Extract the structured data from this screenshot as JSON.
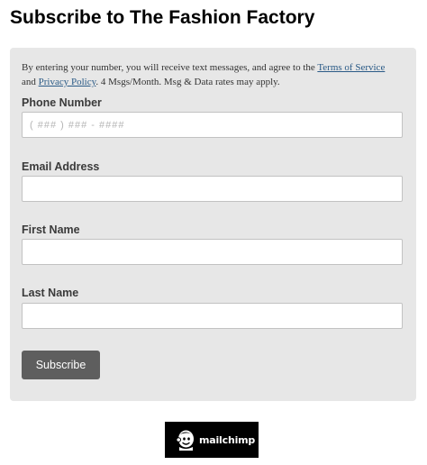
{
  "page": {
    "title": "Subscribe to The Fashion Factory"
  },
  "form": {
    "disclaimer": {
      "prefix": "By entering your number, you will receive text messages, and agree to the ",
      "terms_link": "Terms of Service",
      "middle": " and ",
      "privacy_link": "Privacy Policy",
      "suffix": ". 4 Msgs/Month. Msg & Data rates may apply."
    },
    "fields": {
      "phone": {
        "label": "Phone Number",
        "placeholder": "( ### ) ### - ####",
        "value": ""
      },
      "email": {
        "label": "Email Address",
        "value": ""
      },
      "first_name": {
        "label": "First Name",
        "value": ""
      },
      "last_name": {
        "label": "Last Name",
        "value": ""
      }
    },
    "submit_label": "Subscribe"
  },
  "footer": {
    "badge": {
      "icon": "mailchimp-freddie-icon",
      "text": "mailchimp"
    }
  },
  "colors": {
    "panel_background": "#e7e7e7",
    "button_background": "#5e5e5e",
    "link": "#2a5a86",
    "badge_background": "#000000"
  }
}
